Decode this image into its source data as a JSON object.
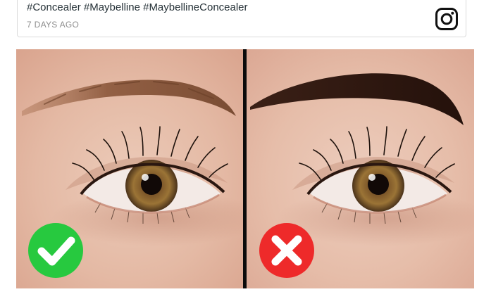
{
  "post": {
    "hashtags": "#Concealer #Maybelline #MaybellineConcealer",
    "timestamp": "7 DAYS AGO",
    "platform_icon": "instagram-icon"
  },
  "image": {
    "left_panel": {
      "verdict": "correct",
      "badge_icon": "checkmark-icon",
      "badge_color": "#27c93f"
    },
    "right_panel": {
      "verdict": "incorrect",
      "badge_icon": "cross-icon",
      "badge_color": "#ee2a2a"
    },
    "divider_color": "#0b0b0b"
  }
}
